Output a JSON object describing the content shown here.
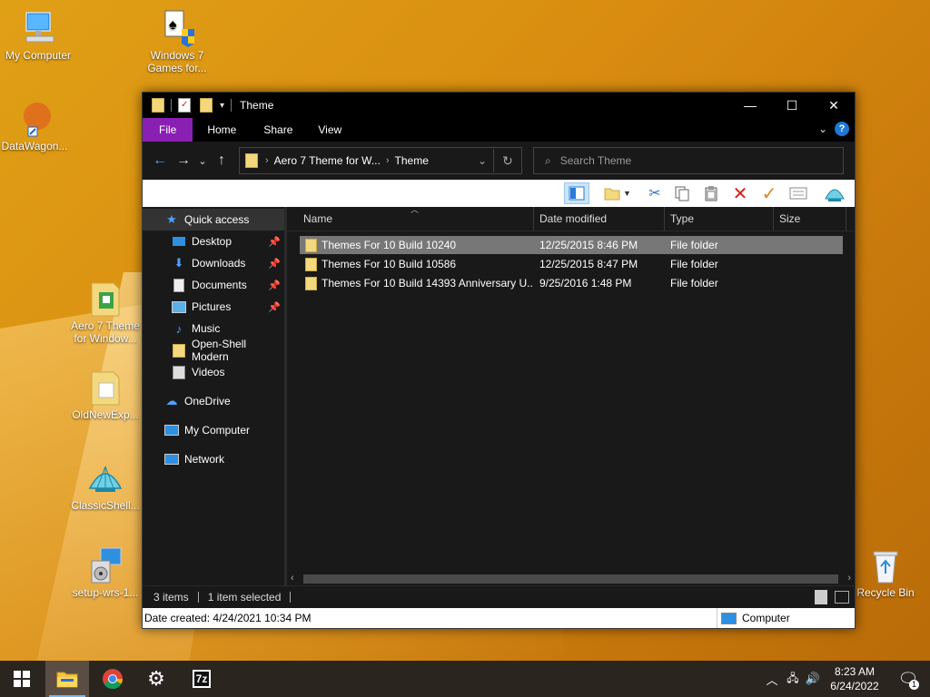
{
  "desktop": {
    "icons": [
      {
        "label": "My Computer"
      },
      {
        "label": "Windows 7 Games for..."
      },
      {
        "label": "DataWagon..."
      },
      {
        "label": "Aero 7 Theme for Window..."
      },
      {
        "label": "OldNewExp..."
      },
      {
        "label": "ClassicShell..."
      },
      {
        "label": "setup-wrs-1..."
      },
      {
        "label": "Recycle Bin"
      }
    ]
  },
  "window": {
    "title": "Theme",
    "ribbon_tabs": [
      "File",
      "Home",
      "Share",
      "View"
    ],
    "help_label": "?",
    "address": {
      "segments": [
        "Aero 7 Theme for W...",
        "Theme"
      ]
    },
    "search_placeholder": "Search Theme",
    "nav": {
      "quick_access": "Quick access",
      "items": [
        {
          "label": "Desktop",
          "pinned": true
        },
        {
          "label": "Downloads",
          "pinned": true
        },
        {
          "label": "Documents",
          "pinned": true
        },
        {
          "label": "Pictures",
          "pinned": true
        },
        {
          "label": "Music",
          "pinned": false
        },
        {
          "label": "Open-Shell Modern",
          "pinned": false
        },
        {
          "label": "Videos",
          "pinned": false
        }
      ],
      "onedrive": "OneDrive",
      "my_computer": "My Computer",
      "network": "Network"
    },
    "columns": [
      "Name",
      "Date modified",
      "Type",
      "Size"
    ],
    "files": [
      {
        "name": "Themes For 10 Build 10240",
        "date": "12/25/2015 8:46 PM",
        "type": "File folder",
        "size": "",
        "selected": true
      },
      {
        "name": "Themes For 10 Build 10586",
        "date": "12/25/2015 8:47 PM",
        "type": "File folder",
        "size": "",
        "selected": false
      },
      {
        "name": "Themes For 10 Build 14393 Anniversary U...",
        "date": "9/25/2016 1:48 PM",
        "type": "File folder",
        "size": "",
        "selected": false
      }
    ],
    "status": {
      "items_count": "3 items",
      "selected": "1 item selected"
    },
    "details": {
      "date_created": "Date created: 4/24/2021 10:34 PM",
      "location": "Computer"
    }
  },
  "taskbar": {
    "time": "8:23 AM",
    "date": "6/24/2022",
    "notification_count": "1",
    "apps": [
      "file-explorer",
      "chrome",
      "settings",
      "7-zip"
    ]
  },
  "colors": {
    "file_tab": "#8a1fb4",
    "accent_blue": "#4fa0ff",
    "selected_row": "#777777",
    "wallpaper": "#d98c10"
  }
}
